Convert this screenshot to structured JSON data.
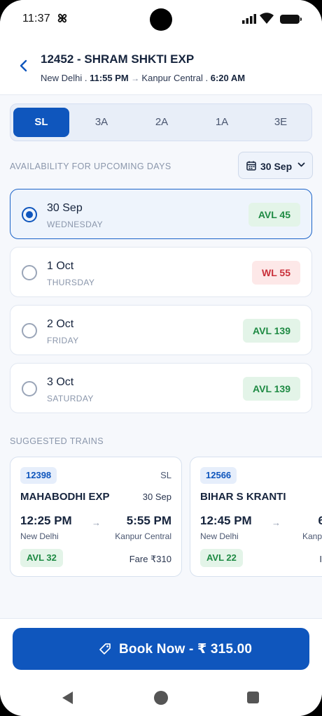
{
  "status": {
    "time": "11:37"
  },
  "header": {
    "title": "12452 - SHRAM SHKTI EXP",
    "from": "New Delhi",
    "sep1": " . ",
    "dep_time": "11:55 PM",
    "arrow": " → ",
    "to": "Kanpur Central",
    "sep2": " . ",
    "arr_time": "6:20 AM"
  },
  "classes": [
    {
      "label": "SL",
      "active": true
    },
    {
      "label": "3A"
    },
    {
      "label": "2A"
    },
    {
      "label": "1A"
    },
    {
      "label": "3E"
    }
  ],
  "availability": {
    "label": "AVAILABILITY FOR UPCOMING DAYS",
    "selected_date": "30 Sep",
    "days": [
      {
        "date": "30 Sep",
        "weekday": "WEDNESDAY",
        "status": "AVL 45",
        "kind": "green",
        "selected": true
      },
      {
        "date": "1 Oct",
        "weekday": "THURSDAY",
        "status": "WL 55",
        "kind": "red"
      },
      {
        "date": "2 Oct",
        "weekday": "FRIDAY",
        "status": "AVL 139",
        "kind": "green"
      },
      {
        "date": "3 Oct",
        "weekday": "SATURDAY",
        "status": "AVL 139",
        "kind": "green"
      }
    ]
  },
  "suggested": {
    "label": "SUGGESTED TRAINS",
    "trains": [
      {
        "number": "12398",
        "class": "SL",
        "name": "MAHABODHI EXP",
        "date": "30 Sep",
        "dep": "12:25 PM",
        "arr": "5:55 PM",
        "from": "New Delhi",
        "to": "Kanpur Central",
        "avail": "AVL 32",
        "fare": "Fare ₹310"
      },
      {
        "number": "12566",
        "class": "",
        "name": "BIHAR S KRANTI",
        "date": "",
        "dep": "12:45 PM",
        "arr": "6",
        "from": "New Delhi",
        "to": "Kanp",
        "avail": "AVL 22",
        "fare": "I"
      }
    ]
  },
  "book": {
    "label": "Book Now - ₹ 315.00"
  },
  "colors": {
    "primary": "#0f56bd",
    "green": "#1e8a43",
    "red": "#c9303a"
  }
}
